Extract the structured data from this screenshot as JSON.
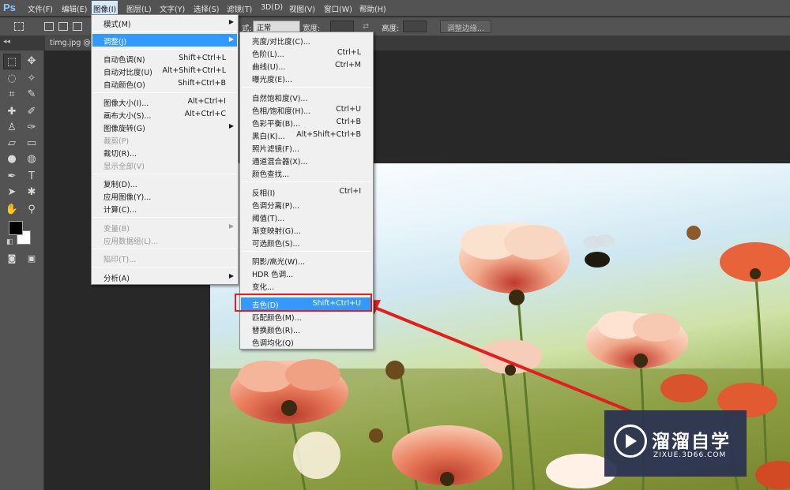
{
  "app": {
    "logo": "Ps"
  },
  "menubar": [
    "文件(F)",
    "编辑(E)",
    "图像(I)",
    "图层(L)",
    "文字(Y)",
    "选择(S)",
    "滤镜(T)",
    "3D(D)",
    "视图(V)",
    "窗口(W)",
    "帮助(H)"
  ],
  "options": {
    "style_label": "式:",
    "style_value": "正常",
    "width_label": "宽度:",
    "height_label": "高度:",
    "refine_edge": "调整边缘..."
  },
  "document_tab": {
    "title": "timg.jpg @"
  },
  "image_menu": [
    {
      "label": "模式(M)",
      "shortcut": "",
      "submenu": true
    },
    {
      "label": "调整(J)",
      "shortcut": "",
      "submenu": true,
      "highlighted": true
    },
    {
      "label": "自动色调(N)",
      "shortcut": "Shift+Ctrl+L"
    },
    {
      "label": "自动对比度(U)",
      "shortcut": "Alt+Shift+Ctrl+L"
    },
    {
      "label": "自动颜色(O)",
      "shortcut": "Shift+Ctrl+B"
    },
    {
      "label": "图像大小(I)...",
      "shortcut": "Alt+Ctrl+I"
    },
    {
      "label": "画布大小(S)...",
      "shortcut": "Alt+Ctrl+C"
    },
    {
      "label": "图像旋转(G)",
      "shortcut": "",
      "submenu": true
    },
    {
      "label": "裁剪(P)",
      "shortcut": "",
      "disabled": true
    },
    {
      "label": "裁切(R)...",
      "shortcut": ""
    },
    {
      "label": "显示全部(V)",
      "shortcut": "",
      "disabled": true
    },
    {
      "label": "复制(D)...",
      "shortcut": ""
    },
    {
      "label": "应用图像(Y)...",
      "shortcut": ""
    },
    {
      "label": "计算(C)...",
      "shortcut": ""
    },
    {
      "label": "变量(B)",
      "shortcut": "",
      "submenu": true,
      "disabled": true
    },
    {
      "label": "应用数据组(L)...",
      "shortcut": "",
      "disabled": true
    },
    {
      "label": "陷印(T)...",
      "shortcut": "",
      "disabled": true
    },
    {
      "label": "分析(A)",
      "shortcut": "",
      "submenu": true
    }
  ],
  "adjust_menu": [
    {
      "label": "亮度/对比度(C)...",
      "shortcut": ""
    },
    {
      "label": "色阶(L)...",
      "shortcut": "Ctrl+L"
    },
    {
      "label": "曲线(U)...",
      "shortcut": "Ctrl+M"
    },
    {
      "label": "曝光度(E)...",
      "shortcut": ""
    },
    {
      "label": "自然饱和度(V)...",
      "shortcut": ""
    },
    {
      "label": "色相/饱和度(H)...",
      "shortcut": "Ctrl+U"
    },
    {
      "label": "色彩平衡(B)...",
      "shortcut": "Ctrl+B"
    },
    {
      "label": "黑白(K)...",
      "shortcut": "Alt+Shift+Ctrl+B"
    },
    {
      "label": "照片滤镜(F)...",
      "shortcut": ""
    },
    {
      "label": "通道混合器(X)...",
      "shortcut": ""
    },
    {
      "label": "颜色查找...",
      "shortcut": ""
    },
    {
      "label": "反相(I)",
      "shortcut": "Ctrl+I"
    },
    {
      "label": "色调分离(P)...",
      "shortcut": ""
    },
    {
      "label": "阈值(T)...",
      "shortcut": ""
    },
    {
      "label": "渐变映射(G)...",
      "shortcut": ""
    },
    {
      "label": "可选颜色(S)...",
      "shortcut": ""
    },
    {
      "label": "阴影/高光(W)...",
      "shortcut": ""
    },
    {
      "label": "HDR 色调...",
      "shortcut": ""
    },
    {
      "label": "变化...",
      "shortcut": ""
    },
    {
      "label": "去色(D)",
      "shortcut": "Shift+Ctrl+U",
      "highlighted": true
    },
    {
      "label": "匹配颜色(M)...",
      "shortcut": ""
    },
    {
      "label": "替换颜色(R)...",
      "shortcut": ""
    },
    {
      "label": "色调均化(Q)",
      "shortcut": ""
    }
  ],
  "watermark": {
    "title": "溜溜自学",
    "url": "ZIXUE.3D66.COM"
  },
  "colors": {
    "highlight": "#3399ff",
    "annotation": "#e0201e"
  }
}
